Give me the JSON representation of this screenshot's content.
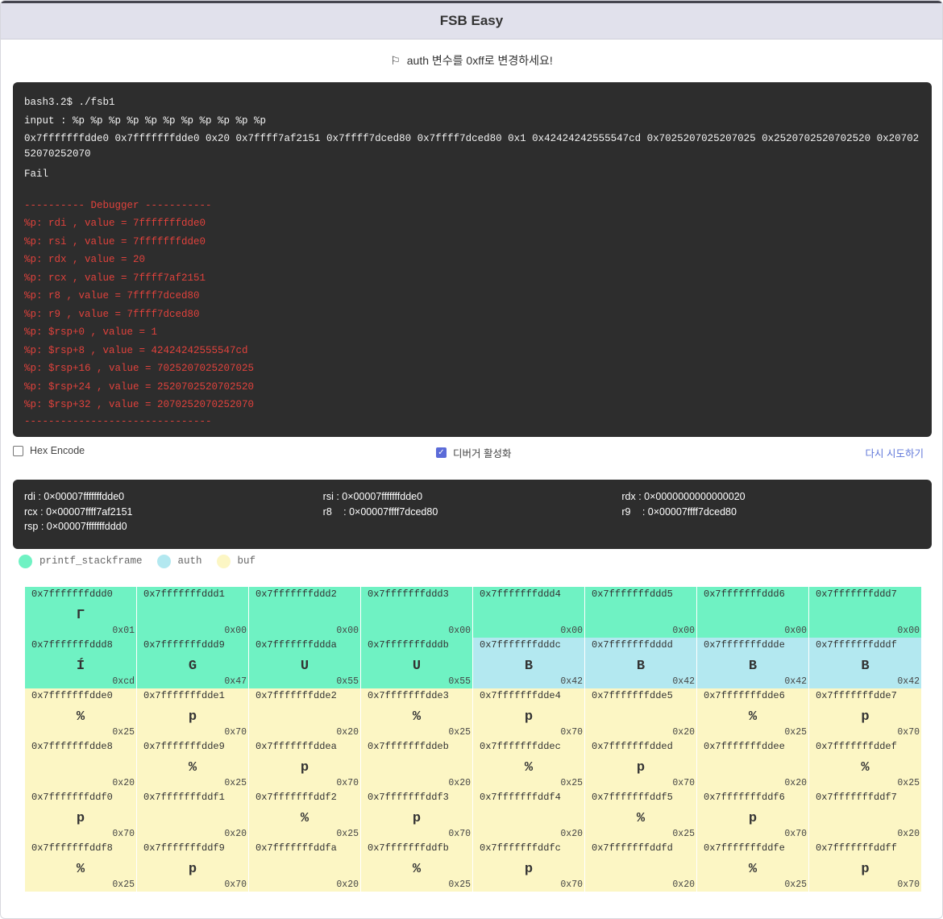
{
  "window": {
    "title": "FSB Easy"
  },
  "mission": {
    "text": "auth 변수를 0xff로 변경하세요!"
  },
  "terminal": {
    "prompt": "bash3.2$ ./fsb1",
    "input": "input : %p %p %p %p %p %p %p %p %p %p %p",
    "output": "0x7fffffffdde0 0x7fffffffdde0 0x20 0x7ffff7af2151 0x7ffff7dced80 0x7ffff7dced80 0x1 0x42424242555547cd 0x7025207025207025 0x2520702520702520 0x2070252070252070",
    "result": "Fail",
    "debug_header": "---------- Debugger -----------",
    "debug_lines": [
      "%p: rdi , value = 7fffffffdde0",
      "%p: rsi , value = 7fffffffdde0",
      "%p: rdx , value = 20",
      "%p: rcx , value = 7ffff7af2151",
      "%p: r8 , value = 7ffff7dced80",
      "%p: r9 , value = 7ffff7dced80",
      "%p: $rsp+0 , value = 1",
      "%p: $rsp+8 , value = 42424242555547cd",
      "%p: $rsp+16 , value = 7025207025207025",
      "%p: $rsp+24 , value = 2520702520702520",
      "%p: $rsp+32 , value = 2070252070252070"
    ],
    "debug_footer": "-------------------------------"
  },
  "options": {
    "hex_encode": {
      "label": "Hex Encode",
      "checked": false
    },
    "debugger": {
      "label": "디버거 활성화",
      "checked": true
    },
    "retry": "다시 시도하기"
  },
  "registers": [
    [
      {
        "name": "rdi",
        "value": "0×00007fffffffdde0"
      },
      {
        "name": "rsi",
        "value": "0×00007fffffffdde0"
      },
      {
        "name": "rdx",
        "value": "0×0000000000000020"
      }
    ],
    [
      {
        "name": "rcx",
        "value": "0×00007ffff7af2151"
      },
      {
        "name": "r8",
        "value": "0×00007ffff7dced80"
      },
      {
        "name": "r9",
        "value": "0×00007ffff7dced80"
      }
    ],
    [
      {
        "name": "rsp",
        "value": "0×00007fffffffddd0"
      }
    ]
  ],
  "legend": [
    {
      "label": "printf_stackframe",
      "color": "#6ff2c3"
    },
    {
      "label": "auth",
      "color": "#b3e8f0"
    },
    {
      "label": "buf",
      "color": "#fcf6c4"
    }
  ],
  "memory": [
    [
      {
        "addr": "0x7fffffffddd0",
        "ch": "Γ",
        "hex": "0x01",
        "r": "stack"
      },
      {
        "addr": "0x7fffffffddd1",
        "ch": "",
        "hex": "0x00",
        "r": "stack"
      },
      {
        "addr": "0x7fffffffddd2",
        "ch": "",
        "hex": "0x00",
        "r": "stack"
      },
      {
        "addr": "0x7fffffffddd3",
        "ch": "",
        "hex": "0x00",
        "r": "stack"
      },
      {
        "addr": "0x7fffffffddd4",
        "ch": "",
        "hex": "0x00",
        "r": "stack"
      },
      {
        "addr": "0x7fffffffddd5",
        "ch": "",
        "hex": "0x00",
        "r": "stack"
      },
      {
        "addr": "0x7fffffffddd6",
        "ch": "",
        "hex": "0x00",
        "r": "stack"
      },
      {
        "addr": "0x7fffffffddd7",
        "ch": "",
        "hex": "0x00",
        "r": "stack"
      }
    ],
    [
      {
        "addr": "0x7fffffffddd8",
        "ch": "Í",
        "hex": "0xcd",
        "r": "stack"
      },
      {
        "addr": "0x7fffffffddd9",
        "ch": "G",
        "hex": "0x47",
        "r": "stack"
      },
      {
        "addr": "0x7fffffffddda",
        "ch": "U",
        "hex": "0x55",
        "r": "stack"
      },
      {
        "addr": "0x7fffffffdddb",
        "ch": "U",
        "hex": "0x55",
        "r": "stack"
      },
      {
        "addr": "0x7fffffffdddc",
        "ch": "B",
        "hex": "0x42",
        "r": "auth"
      },
      {
        "addr": "0x7fffffffdddd",
        "ch": "B",
        "hex": "0x42",
        "r": "auth"
      },
      {
        "addr": "0x7fffffffddde",
        "ch": "B",
        "hex": "0x42",
        "r": "auth"
      },
      {
        "addr": "0x7fffffffdddf",
        "ch": "B",
        "hex": "0x42",
        "r": "auth"
      }
    ],
    [
      {
        "addr": "0x7fffffffdde0",
        "ch": "%",
        "hex": "0x25",
        "r": "buf"
      },
      {
        "addr": "0x7fffffffdde1",
        "ch": "p",
        "hex": "0x70",
        "r": "buf"
      },
      {
        "addr": "0x7fffffffdde2",
        "ch": "",
        "hex": "0x20",
        "r": "buf"
      },
      {
        "addr": "0x7fffffffdde3",
        "ch": "%",
        "hex": "0x25",
        "r": "buf"
      },
      {
        "addr": "0x7fffffffdde4",
        "ch": "p",
        "hex": "0x70",
        "r": "buf"
      },
      {
        "addr": "0x7fffffffdde5",
        "ch": "",
        "hex": "0x20",
        "r": "buf"
      },
      {
        "addr": "0x7fffffffdde6",
        "ch": "%",
        "hex": "0x25",
        "r": "buf"
      },
      {
        "addr": "0x7fffffffdde7",
        "ch": "p",
        "hex": "0x70",
        "r": "buf"
      }
    ],
    [
      {
        "addr": "0x7fffffffdde8",
        "ch": "",
        "hex": "0x20",
        "r": "buf"
      },
      {
        "addr": "0x7fffffffdde9",
        "ch": "%",
        "hex": "0x25",
        "r": "buf"
      },
      {
        "addr": "0x7fffffffddea",
        "ch": "p",
        "hex": "0x70",
        "r": "buf"
      },
      {
        "addr": "0x7fffffffddeb",
        "ch": "",
        "hex": "0x20",
        "r": "buf"
      },
      {
        "addr": "0x7fffffffddec",
        "ch": "%",
        "hex": "0x25",
        "r": "buf"
      },
      {
        "addr": "0x7fffffffdded",
        "ch": "p",
        "hex": "0x70",
        "r": "buf"
      },
      {
        "addr": "0x7fffffffddee",
        "ch": "",
        "hex": "0x20",
        "r": "buf"
      },
      {
        "addr": "0x7fffffffddef",
        "ch": "%",
        "hex": "0x25",
        "r": "buf"
      }
    ],
    [
      {
        "addr": "0x7fffffffddf0",
        "ch": "p",
        "hex": "0x70",
        "r": "buf"
      },
      {
        "addr": "0x7fffffffddf1",
        "ch": "",
        "hex": "0x20",
        "r": "buf"
      },
      {
        "addr": "0x7fffffffddf2",
        "ch": "%",
        "hex": "0x25",
        "r": "buf"
      },
      {
        "addr": "0x7fffffffddf3",
        "ch": "p",
        "hex": "0x70",
        "r": "buf"
      },
      {
        "addr": "0x7fffffffddf4",
        "ch": "",
        "hex": "0x20",
        "r": "buf"
      },
      {
        "addr": "0x7fffffffddf5",
        "ch": "%",
        "hex": "0x25",
        "r": "buf"
      },
      {
        "addr": "0x7fffffffddf6",
        "ch": "p",
        "hex": "0x70",
        "r": "buf"
      },
      {
        "addr": "0x7fffffffddf7",
        "ch": "",
        "hex": "0x20",
        "r": "buf"
      }
    ],
    [
      {
        "addr": "0x7fffffffddf8",
        "ch": "%",
        "hex": "0x25",
        "r": "buf"
      },
      {
        "addr": "0x7fffffffddf9",
        "ch": "p",
        "hex": "0x70",
        "r": "buf"
      },
      {
        "addr": "0x7fffffffddfa",
        "ch": "",
        "hex": "0x20",
        "r": "buf"
      },
      {
        "addr": "0x7fffffffddfb",
        "ch": "%",
        "hex": "0x25",
        "r": "buf"
      },
      {
        "addr": "0x7fffffffddfc",
        "ch": "p",
        "hex": "0x70",
        "r": "buf"
      },
      {
        "addr": "0x7fffffffddfd",
        "ch": "",
        "hex": "0x20",
        "r": "buf"
      },
      {
        "addr": "0x7fffffffddfe",
        "ch": "%",
        "hex": "0x25",
        "r": "buf"
      },
      {
        "addr": "0x7fffffffddff",
        "ch": "p",
        "hex": "0x70",
        "r": "buf"
      }
    ]
  ]
}
